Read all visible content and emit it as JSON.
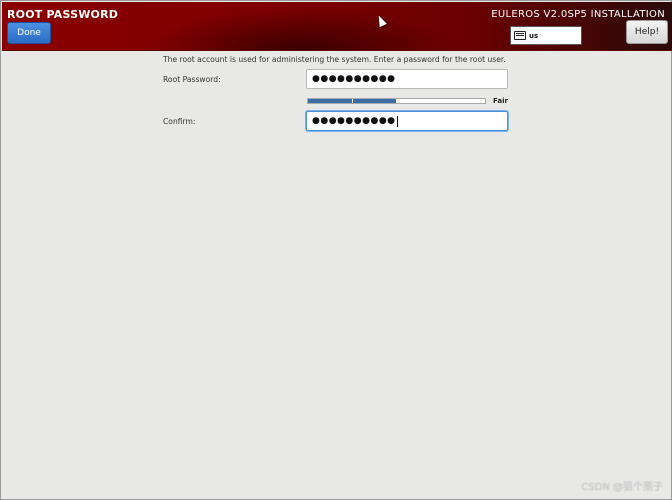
{
  "header": {
    "title": "ROOT PASSWORD",
    "done_label": "Done",
    "product": "EULEROS V2.0SP5 INSTALLATION",
    "keyboard_layout": "us",
    "help_label": "Help!"
  },
  "form": {
    "description": "The root account is used for administering the system.  Enter a password for the root user.",
    "root_password_label": "Root Password:",
    "root_password_value": "●●●●●●●●●●",
    "confirm_label": "Confirm:",
    "confirm_value": "●●●●●●●●●●",
    "strength_label": "Fair",
    "strength_level": 0.5,
    "strength_segments": 4,
    "strength_fill_color": "#3a6ea5"
  },
  "watermark": "CSDN @狙个栗子"
}
